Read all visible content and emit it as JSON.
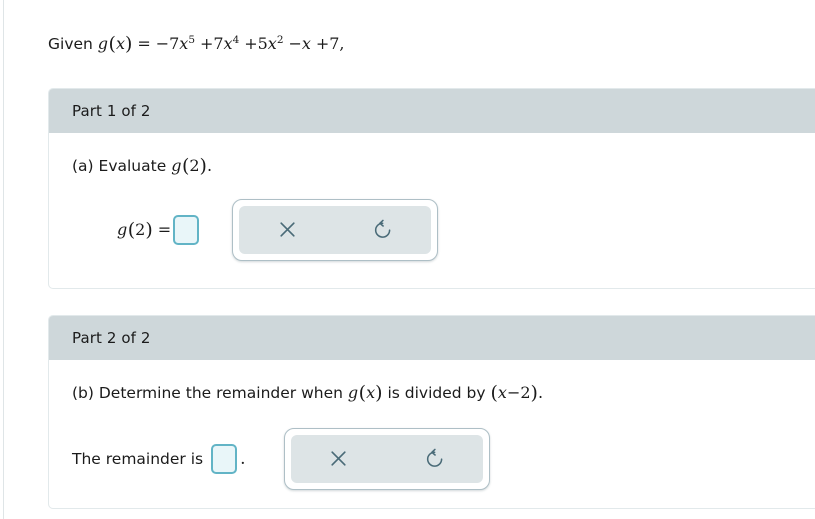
{
  "prompt": {
    "lead": "Given",
    "function_name": "g",
    "variable": "x",
    "equals": "=",
    "terms": [
      {
        "sign": "−",
        "coefficient": "7",
        "variable": "x",
        "exponent": "5"
      },
      {
        "sign": "+",
        "coefficient": "7",
        "variable": "x",
        "exponent": "4"
      },
      {
        "sign": "+",
        "coefficient": "5",
        "variable": "x",
        "exponent": "2"
      },
      {
        "sign": "−",
        "coefficient": "",
        "variable": "x",
        "exponent": ""
      },
      {
        "sign": "+",
        "coefficient": "7",
        "variable": "",
        "exponent": ""
      }
    ],
    "trailing_comma": ",",
    "full_text": "Given g(x) = −7x⁵ + 7x⁴ + 5x² − x + 7,"
  },
  "parts": [
    {
      "header": "Part 1 of 2",
      "question_label": "(a)",
      "question_text": "Evaluate",
      "question_math": "g(2).",
      "question_full": "(a) Evaluate g(2).",
      "answer_prefix": "g(2) =",
      "answer_value": "",
      "answer_placeholder": "",
      "suffix": "",
      "tools": [
        {
          "name": "clear",
          "icon": "close-x-icon",
          "label": "✕"
        },
        {
          "name": "undo",
          "icon": "undo-arrow-icon",
          "label": "↺"
        }
      ]
    },
    {
      "header": "Part 2 of 2",
      "question_label": "(b)",
      "question_text": "Determine the remainder when",
      "question_math": "g(x) is divided by (x−2).",
      "question_full": "(b) Determine the remainder when g(x) is divided by (x−2).",
      "answer_prefix": "The remainder is",
      "answer_value": "",
      "answer_placeholder": "",
      "suffix": ".",
      "tools": [
        {
          "name": "clear",
          "icon": "close-x-icon",
          "label": "✕"
        },
        {
          "name": "undo",
          "icon": "undo-arrow-icon",
          "label": "↺"
        }
      ]
    }
  ],
  "colors": {
    "header_gray": "#ced7da",
    "tool_panel_gray": "#dde4e6",
    "answer_box_border": "#62b4c6",
    "answer_box_fill": "#e9f6f9",
    "icon_slate": "#4a6b78",
    "card_border": "#e2e9eb",
    "page_background": "#ffffff"
  }
}
